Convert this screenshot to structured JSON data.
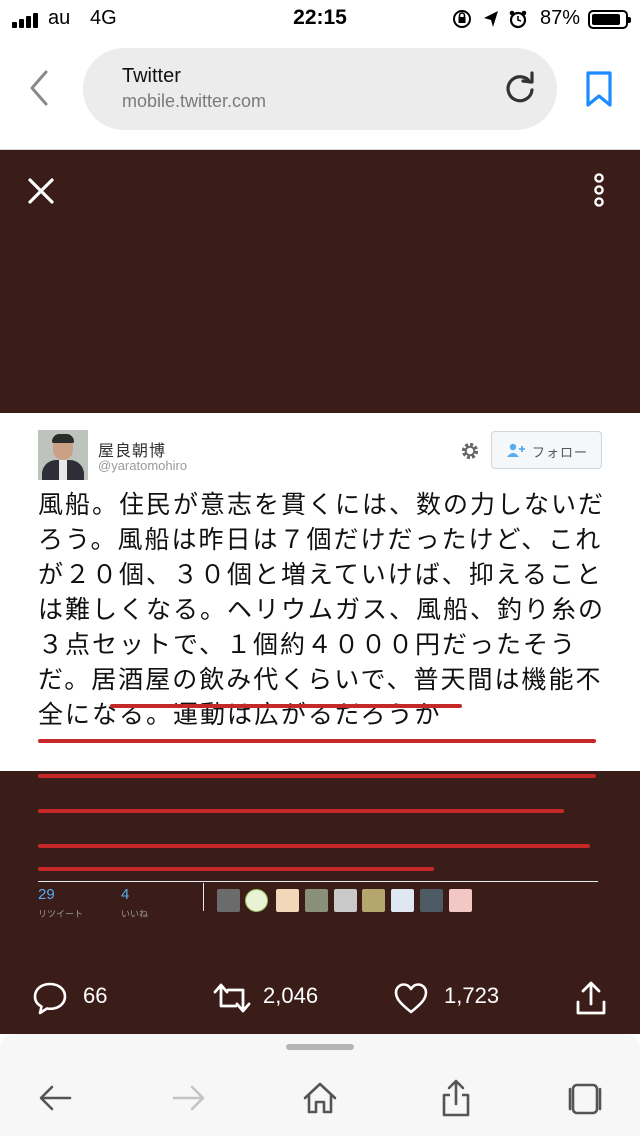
{
  "status_bar": {
    "carrier": "au",
    "network": "4G",
    "time": "22:15",
    "battery": "87%",
    "battery_level": 0.87
  },
  "browser": {
    "page_title": "Twitter",
    "url": "mobile.twitter.com"
  },
  "tweet_image": {
    "author_name": "屋良朝博",
    "author_handle": "@yaratomohiro",
    "follow_label": "フォロー",
    "text_lines": [
      "風船。住民が意志を貫くには、数の力しないだ",
      "ろう。風船は昨日は７個だけだったけど、これ",
      "が２０個、３０個と増えていけば、抑えること",
      "は難しくなる。ヘリウムガス、風船、釣り糸の",
      "３点セットで、１個約４０００円だったそう",
      "だ。居酒屋の飲み代くらいで、普天間は機能不",
      "全になる。運動は広がるだろうか"
    ],
    "retweets": "29",
    "retweets_label": "リツイート",
    "likes": "4",
    "likes_label": "いいね"
  },
  "actions": {
    "replies": "66",
    "retweets": "2,046",
    "likes": "1,723"
  },
  "colors": {
    "viewer_background": "#3a1d19",
    "underline": "#c62828",
    "link_blue": "#1a8cff",
    "stat_blue": "#55acee"
  }
}
